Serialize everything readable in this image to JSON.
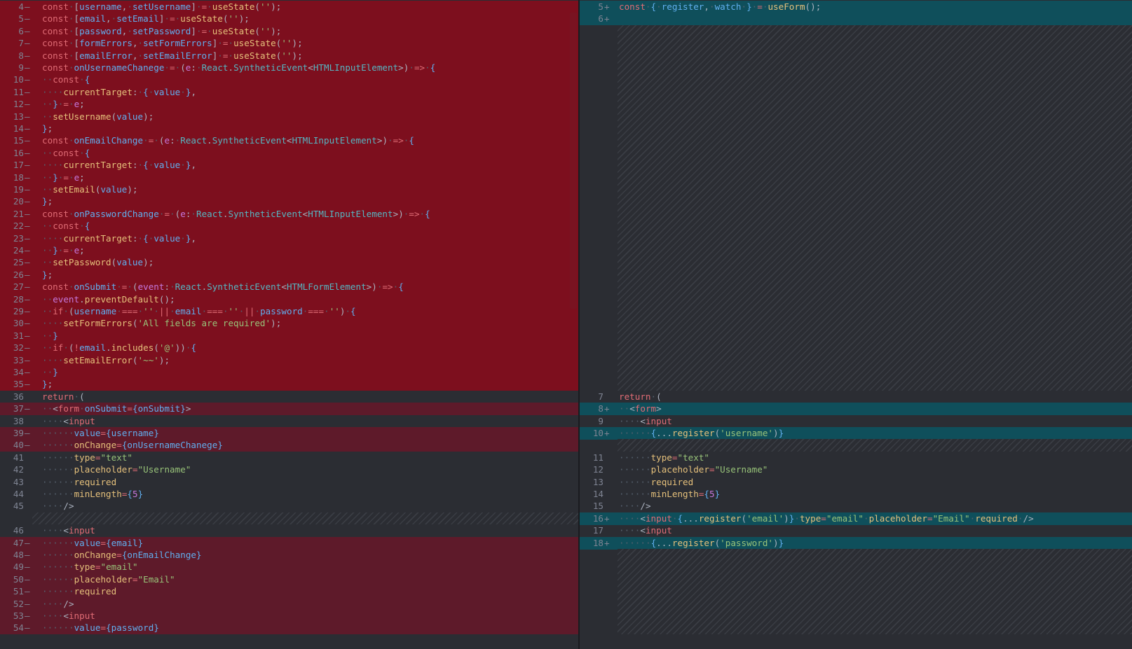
{
  "diff": {
    "left": {
      "lines": [
        {
          "n": "4",
          "m": "—",
          "t": "del",
          "code": "const [username, setUsername] = useState('');"
        },
        {
          "n": "5",
          "m": "—",
          "t": "del",
          "code": "const [email, setEmail] = useState('');"
        },
        {
          "n": "6",
          "m": "—",
          "t": "del",
          "code": "const [password, setPassword] = useState('');"
        },
        {
          "n": "7",
          "m": "—",
          "t": "del",
          "code": "const [formErrors, setFormErrors] = useState('');"
        },
        {
          "n": "8",
          "m": "—",
          "t": "del",
          "code": "const [emailError, setEmailError] = useState('');"
        },
        {
          "n": "9",
          "m": "—",
          "t": "del",
          "code": "const onUsernameChanege = (e: React.SyntheticEvent<HTMLInputElement>) => {"
        },
        {
          "n": "10",
          "m": "—",
          "t": "del",
          "code": "  const {"
        },
        {
          "n": "11",
          "m": "—",
          "t": "del",
          "code": "    currentTarget: { value },"
        },
        {
          "n": "12",
          "m": "—",
          "t": "del",
          "code": "  } = e;"
        },
        {
          "n": "13",
          "m": "—",
          "t": "del",
          "code": "  setUsername(value);"
        },
        {
          "n": "14",
          "m": "—",
          "t": "del",
          "code": "};"
        },
        {
          "n": "15",
          "m": "—",
          "t": "del",
          "code": "const onEmailChange = (e: React.SyntheticEvent<HTMLInputElement>) => {"
        },
        {
          "n": "16",
          "m": "—",
          "t": "del",
          "code": "  const {"
        },
        {
          "n": "17",
          "m": "—",
          "t": "del",
          "code": "    currentTarget: { value },"
        },
        {
          "n": "18",
          "m": "—",
          "t": "del",
          "code": "  } = e;"
        },
        {
          "n": "19",
          "m": "—",
          "t": "del",
          "code": "  setEmail(value);"
        },
        {
          "n": "20",
          "m": "—",
          "t": "del",
          "code": "};"
        },
        {
          "n": "21",
          "m": "—",
          "t": "del",
          "code": "const onPasswordChange = (e: React.SyntheticEvent<HTMLInputElement>) => {"
        },
        {
          "n": "22",
          "m": "—",
          "t": "del",
          "code": "  const {"
        },
        {
          "n": "23",
          "m": "—",
          "t": "del",
          "code": "    currentTarget: { value },"
        },
        {
          "n": "24",
          "m": "—",
          "t": "del",
          "code": "  } = e;"
        },
        {
          "n": "25",
          "m": "—",
          "t": "del",
          "code": "  setPassword(value);"
        },
        {
          "n": "26",
          "m": "—",
          "t": "del",
          "code": "};"
        },
        {
          "n": "27",
          "m": "—",
          "t": "del",
          "code": "const onSubmit = (event: React.SyntheticEvent<HTMLFormElement>) => {"
        },
        {
          "n": "28",
          "m": "—",
          "t": "del",
          "code": "  event.preventDefault();"
        },
        {
          "n": "29",
          "m": "—",
          "t": "del",
          "code": "  if (username === '' || email === '' || password === '') {"
        },
        {
          "n": "30",
          "m": "—",
          "t": "del",
          "code": "    setFormErrors('All fields are required');"
        },
        {
          "n": "31",
          "m": "—",
          "t": "del",
          "code": "  }"
        },
        {
          "n": "32",
          "m": "—",
          "t": "del",
          "code": "  if (!email.includes('@')) {"
        },
        {
          "n": "33",
          "m": "—",
          "t": "del",
          "code": "    setEmailError('~~');"
        },
        {
          "n": "34",
          "m": "—",
          "t": "del",
          "code": "  }"
        },
        {
          "n": "35",
          "m": "—",
          "t": "del",
          "code": "};"
        },
        {
          "n": "36",
          "m": "",
          "t": "ctx",
          "code": "return ("
        },
        {
          "n": "37",
          "m": "—",
          "t": "del2",
          "code": "  <form onSubmit={onSubmit}>"
        },
        {
          "n": "38",
          "m": "",
          "t": "ctx",
          "code": "    <input"
        },
        {
          "n": "39",
          "m": "—",
          "t": "del2",
          "code": "      value={username}"
        },
        {
          "n": "40",
          "m": "—",
          "t": "del2",
          "code": "      onChange={onUsernameChanege}"
        },
        {
          "n": "41",
          "m": "",
          "t": "ctx",
          "code": "      type=\"text\""
        },
        {
          "n": "42",
          "m": "",
          "t": "ctx",
          "code": "      placeholder=\"Username\""
        },
        {
          "n": "43",
          "m": "",
          "t": "ctx",
          "code": "      required"
        },
        {
          "n": "44",
          "m": "",
          "t": "ctx",
          "code": "      minLength={5}"
        },
        {
          "n": "45",
          "m": "",
          "t": "ctx",
          "code": "    />"
        },
        {
          "n": "",
          "m": "",
          "t": "hatch",
          "code": ""
        },
        {
          "n": "46",
          "m": "",
          "t": "ctx",
          "code": "    <input"
        },
        {
          "n": "47",
          "m": "—",
          "t": "del2",
          "code": "      value={email}"
        },
        {
          "n": "48",
          "m": "—",
          "t": "del2",
          "code": "      onChange={onEmailChange}"
        },
        {
          "n": "49",
          "m": "—",
          "t": "del2",
          "code": "      type=\"email\""
        },
        {
          "n": "50",
          "m": "—",
          "t": "del2",
          "code": "      placeholder=\"Email\""
        },
        {
          "n": "51",
          "m": "—",
          "t": "del2",
          "code": "      required"
        },
        {
          "n": "52",
          "m": "—",
          "t": "del2",
          "code": "    />"
        },
        {
          "n": "53",
          "m": "—",
          "t": "del2",
          "code": "    <input"
        },
        {
          "n": "54",
          "m": "—",
          "t": "del2",
          "code": "      value={password}"
        }
      ]
    },
    "right": {
      "lines": [
        {
          "n": "5",
          "m": "+",
          "t": "add",
          "code": "const { register, watch } = useForm();"
        },
        {
          "n": "6",
          "m": "+",
          "t": "add",
          "code": ""
        },
        {
          "n": "",
          "m": "",
          "t": "hatchblock",
          "rows": 30,
          "code": ""
        },
        {
          "n": "7",
          "m": "",
          "t": "ctx",
          "code": "return ("
        },
        {
          "n": "8",
          "m": "+",
          "t": "add",
          "code": "  <form>"
        },
        {
          "n": "9",
          "m": "",
          "t": "ctx",
          "code": "    <input"
        },
        {
          "n": "10",
          "m": "+",
          "t": "add",
          "code": "      {...register('username')}"
        },
        {
          "n": "",
          "m": "",
          "t": "hatch",
          "code": ""
        },
        {
          "n": "11",
          "m": "",
          "t": "ctx",
          "code": "      type=\"text\""
        },
        {
          "n": "12",
          "m": "",
          "t": "ctx",
          "code": "      placeholder=\"Username\""
        },
        {
          "n": "13",
          "m": "",
          "t": "ctx",
          "code": "      required"
        },
        {
          "n": "14",
          "m": "",
          "t": "ctx",
          "code": "      minLength={5}"
        },
        {
          "n": "15",
          "m": "",
          "t": "ctx",
          "code": "    />"
        },
        {
          "n": "16",
          "m": "+",
          "t": "add",
          "code": "    <input {...register('email')} type=\"email\" placeholder=\"Email\" required />"
        },
        {
          "n": "17",
          "m": "",
          "t": "ctx",
          "code": "    <input"
        },
        {
          "n": "18",
          "m": "+",
          "t": "add",
          "code": "      {...register('password')}"
        },
        {
          "n": "",
          "m": "",
          "t": "hatchblock",
          "rows": 7,
          "code": ""
        }
      ]
    }
  },
  "colors": {
    "deleted": "#7d0f1e",
    "deleted_light": "#5e1a2a",
    "added": "#0f4f5b",
    "background": "#2b2d33"
  }
}
